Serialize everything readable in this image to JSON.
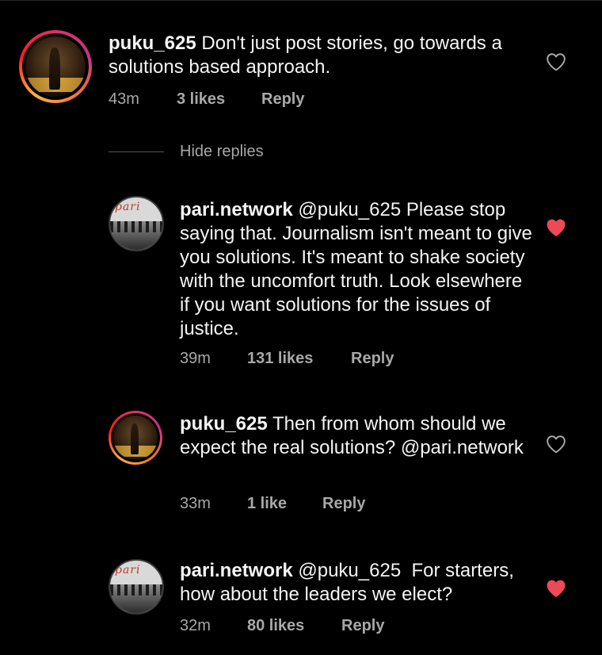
{
  "comments": [
    {
      "username": "puku_625",
      "text": "Don't just post stories, go towards a solutions based approach.",
      "time": "43m",
      "likes": "3 likes",
      "reply": "Reply",
      "liked": false
    },
    {
      "username": "pari.network",
      "text": "@puku_625 Please stop saying that. Journalism isn't meant to give you solutions. It's meant to shake society with the uncomfort truth. Look elsewhere if you want solutions for the issues of justice.",
      "time": "39m",
      "likes": "131 likes",
      "reply": "Reply",
      "liked": true
    },
    {
      "username": "puku_625",
      "text": "Then from whom should we expect the real solutions? @pari.network",
      "time": "33m",
      "likes": "1 like",
      "reply": "Reply",
      "liked": false
    },
    {
      "username": "pari.network",
      "text": "@puku_625  For starters, how about the leaders we elect?",
      "time": "32m",
      "likes": "80 likes",
      "reply": "Reply",
      "liked": true
    }
  ],
  "hide_replies": "Hide replies",
  "avatar_logo_text": "pari",
  "colors": {
    "background": "#000000",
    "heart_liked": "#ed4956",
    "heart_outline": "#a8a8a8",
    "meta_text": "#a8a8a8"
  },
  "icons": {
    "like_outline": "heart-outline-icon",
    "like_filled": "heart-filled-icon"
  }
}
